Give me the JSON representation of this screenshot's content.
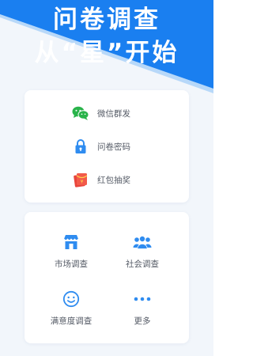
{
  "colors": {
    "background": "#f2f6fb",
    "hero_blue": "#1a7ff0",
    "accent_blue": "#2f8cf0",
    "wechat_green": "#29b34a",
    "redpacket_red": "#e8453c"
  },
  "hero": {
    "line1": "问卷调查",
    "line2": "从“星”开始"
  },
  "share_card": {
    "items": [
      {
        "label": "微信群发",
        "icon": "wechat-icon"
      },
      {
        "label": "问卷密码",
        "icon": "lock-icon"
      },
      {
        "label": "红包抽奖",
        "icon": "red-packet-icon"
      }
    ]
  },
  "survey_card": {
    "items": [
      {
        "label": "市场调查",
        "icon": "store-icon"
      },
      {
        "label": "社会调查",
        "icon": "people-icon"
      },
      {
        "label": "满意度调查",
        "icon": "smiley-icon"
      },
      {
        "label": "更多",
        "icon": "more-dots-icon"
      }
    ]
  }
}
